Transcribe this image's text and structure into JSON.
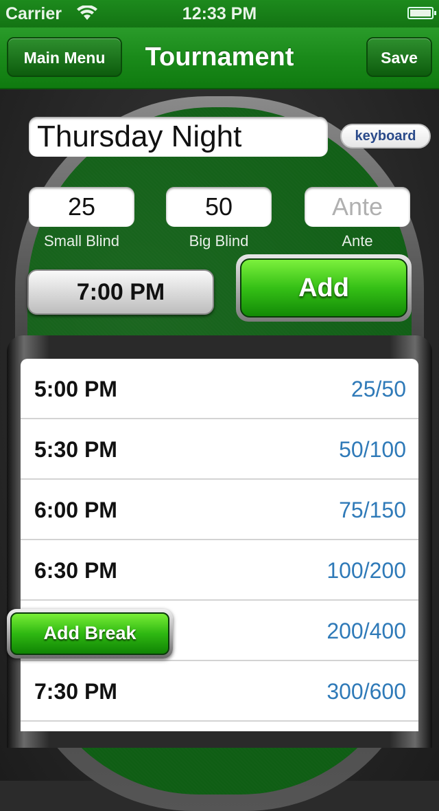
{
  "status_bar": {
    "carrier": "Carrier",
    "time": "12:33 PM"
  },
  "nav": {
    "left_button": "Main Menu",
    "title": "Tournament",
    "right_button": "Save"
  },
  "form": {
    "name": "Thursday Night",
    "keyboard_button": "keyboard",
    "small_blind": {
      "value": "25",
      "label": "Small Blind"
    },
    "big_blind": {
      "value": "50",
      "label": "Big Blind"
    },
    "ante": {
      "placeholder": "Ante",
      "label": "Ante"
    },
    "time": "7:00 PM",
    "add_button": "Add"
  },
  "levels": [
    {
      "time": "5:00 PM",
      "blinds": "25/50"
    },
    {
      "time": "5:30 PM",
      "blinds": "50/100"
    },
    {
      "time": "6:00 PM",
      "blinds": "75/150"
    },
    {
      "time": "6:30 PM",
      "blinds": "100/200"
    },
    {
      "time": "",
      "blinds": "200/400"
    },
    {
      "time": "7:30 PM",
      "blinds": "300/600"
    },
    {
      "time": "",
      "blinds": ""
    }
  ],
  "add_break_button": "Add Break",
  "colors": {
    "nav_green": "#1a8a1a",
    "felt_green": "#116016",
    "blind_blue": "#2f7ab8",
    "button_green": "#35c016"
  }
}
